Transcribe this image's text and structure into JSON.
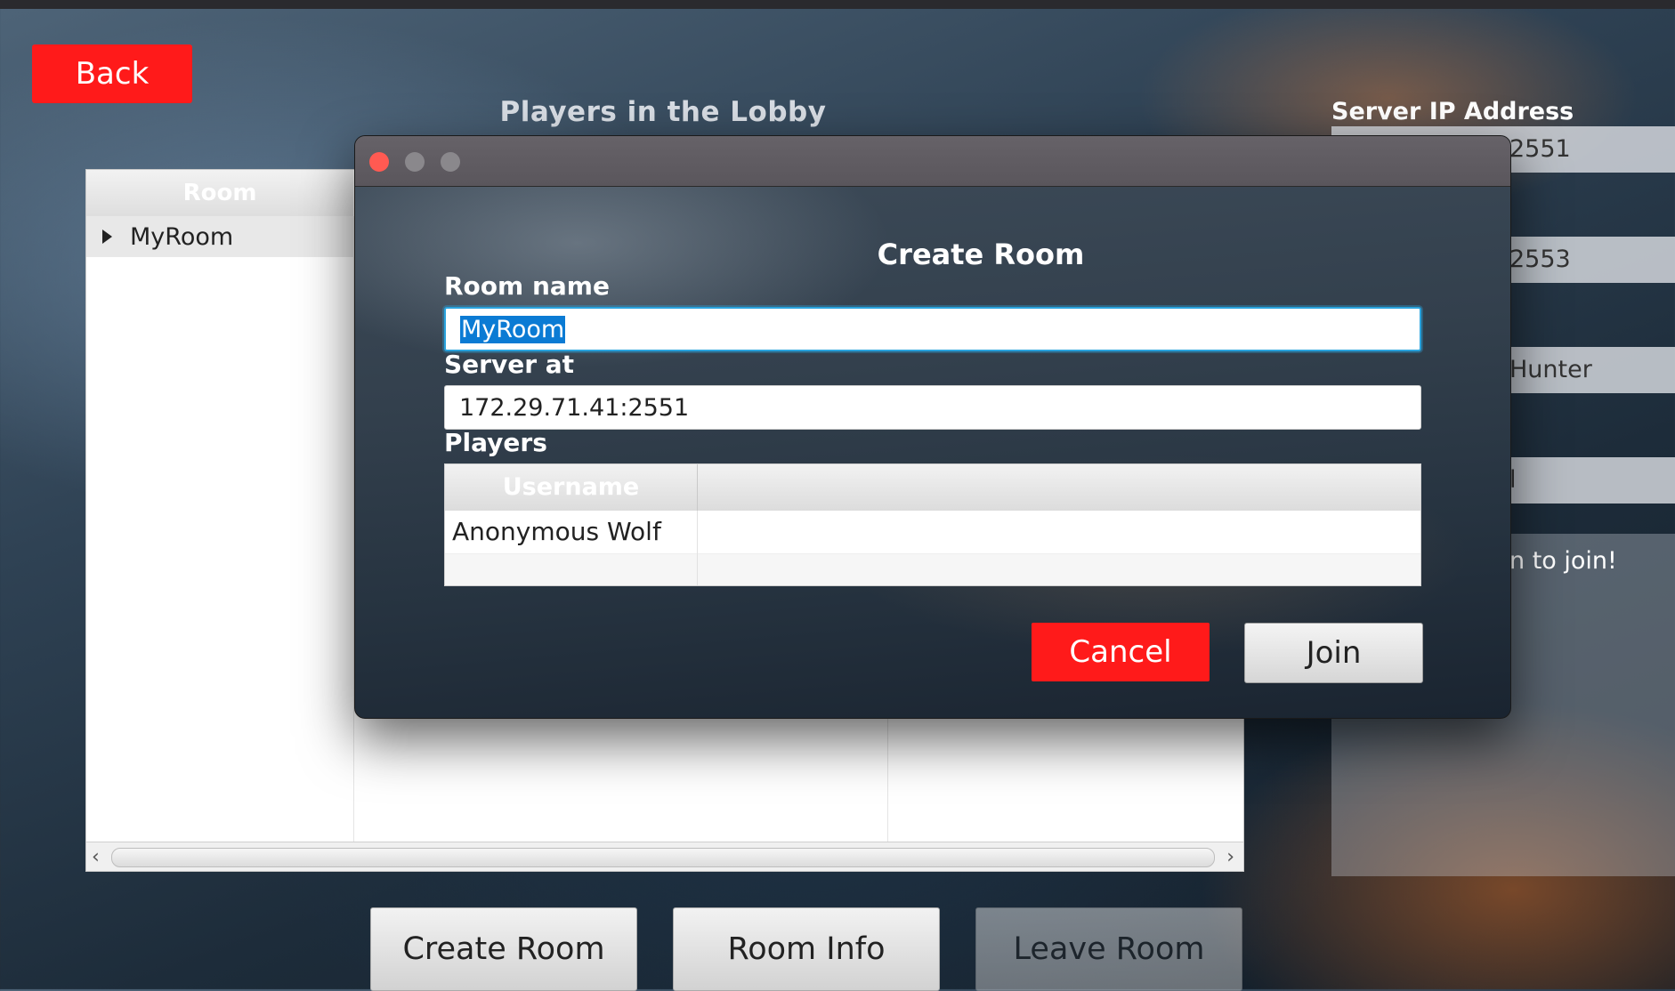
{
  "lobby": {
    "back_label": "Back",
    "title": "Players in the Lobby",
    "room_table": {
      "columns": [
        "Room"
      ],
      "rows": [
        {
          "name": "MyRoom"
        }
      ]
    },
    "buttons": {
      "create_room": "Create Room",
      "room_info": "Room Info",
      "leave_room": "Leave Room"
    }
  },
  "right_panel": {
    "server_ip_label": "Server IP Address",
    "field_values": [
      "2551",
      "2553",
      "Hunter",
      "l"
    ],
    "hint_fragment": "n to join!"
  },
  "dialog": {
    "heading": "Create Room",
    "room_name_label": "Room name",
    "room_name_value": "MyRoom",
    "server_label": "Server at",
    "server_value": "172.29.71.41:2551",
    "players_label": "Players",
    "players_table": {
      "columns": [
        "Username",
        ""
      ],
      "rows": [
        [
          "Anonymous Wolf",
          ""
        ]
      ]
    },
    "cancel_label": "Cancel",
    "join_label": "Join"
  },
  "colors": {
    "danger": "#ff1a1a",
    "focus": "#2aa3dd",
    "selection": "#0b7bd4"
  }
}
